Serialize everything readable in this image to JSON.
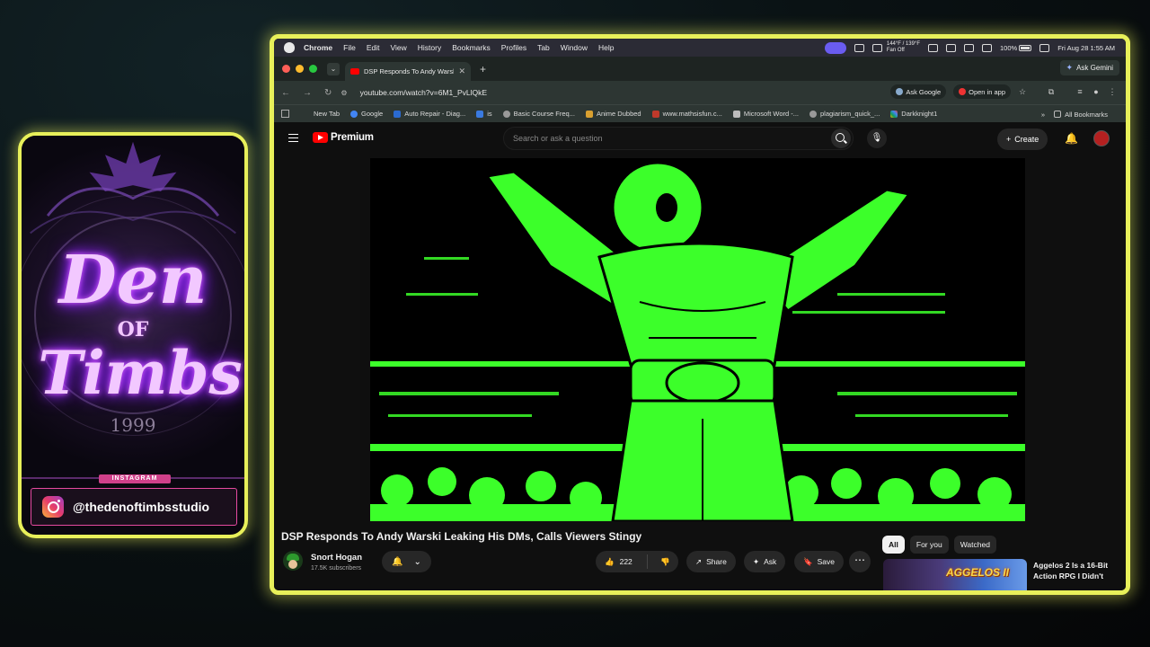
{
  "promo": {
    "title_line1": "Den",
    "title_of": "OF",
    "title_line2": "Timbs",
    "year": "1999",
    "badge": "INSTAGRAM",
    "handle": "@thedenoftimbsstudio"
  },
  "menubar": {
    "app": "Chrome",
    "items": [
      "File",
      "Edit",
      "View",
      "History",
      "Bookmarks",
      "Profiles",
      "Tab",
      "Window",
      "Help"
    ],
    "temp": "144°F / 139°F",
    "fan": "Fan Off",
    "battery": "100%",
    "datetime": "Fri Aug 28  1:55 AM"
  },
  "browser": {
    "tab_title": "DSP Responds To Andy Warski",
    "ask_gemini": "Ask Gemini",
    "url": "youtube.com/watch?v=6M1_PvLlQkE",
    "ask_google": "Ask Google",
    "open_in_app": "Open in app",
    "bookmarks": [
      "New Tab",
      "Google",
      "Auto Repair - Diag...",
      "is",
      "Basic Course Freq...",
      "Anime Dubbed",
      "www.mathsisfun.c...",
      "Microsoft Word -...",
      "plagiarism_quick_...",
      "Darkknight1"
    ],
    "all_bookmarks": "All Bookmarks"
  },
  "youtube": {
    "logo_text": "Premium",
    "search_placeholder": "Search or ask a question",
    "create_label": "Create",
    "video_title": "DSP Responds To Andy Warski Leaking His DMs, Calls Viewers Stingy",
    "channel_name": "Snort Hogan",
    "subscribers": "17.5K subscribers",
    "likes": "222",
    "share_label": "Share",
    "ask_label": "Ask",
    "save_label": "Save",
    "chips": [
      "All",
      "For you",
      "Watched"
    ],
    "rec_thumb_text": "AGGELOS II",
    "rec_title": "Aggelos 2 Is a 16-Bit Action RPG I Didn't"
  },
  "colors": {
    "frame_glow": "#e8f05a",
    "video_green": "#3cff2a",
    "neon_purple": "#d35cff",
    "yt_red": "#ff0000"
  }
}
